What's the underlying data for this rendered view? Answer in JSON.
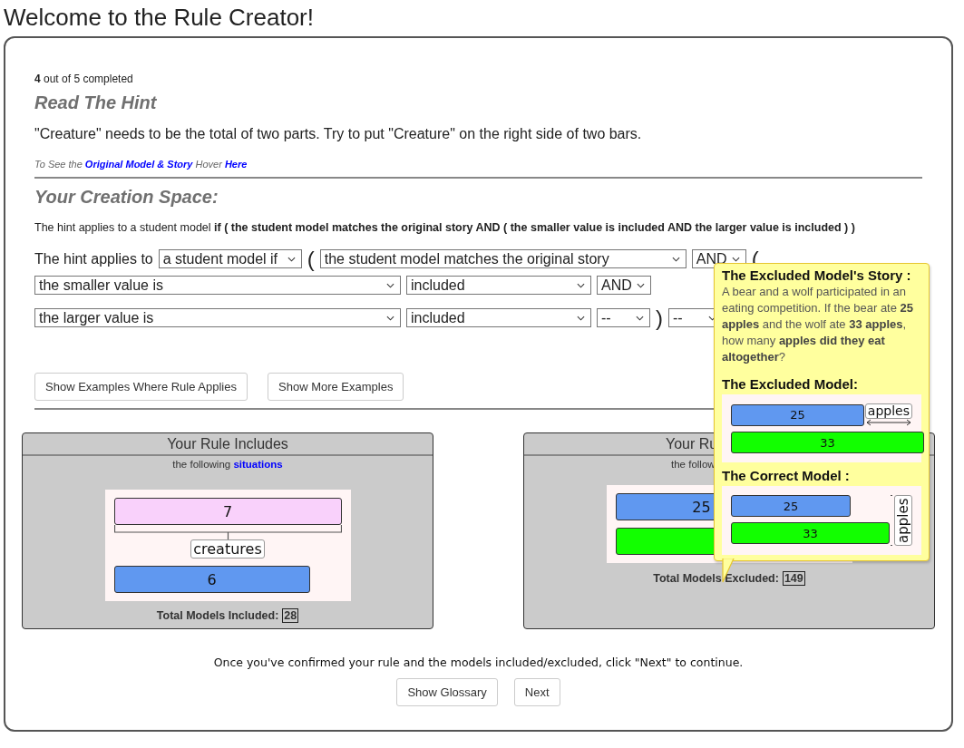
{
  "page_title": "Welcome to the Rule Creator!",
  "progress": {
    "count": "4",
    "text": "out of 5 completed"
  },
  "hint": {
    "heading": "Read The Hint",
    "text": "\"Creature\" needs to be the total of two parts. Try to put \"Creature\" on the right side of two bars.",
    "note_prefix": "To See the",
    "note_link": "Original Model & Story",
    "note_middle": "Hover",
    "note_link_2": "Here"
  },
  "creation": {
    "heading": "Your Creation Space:",
    "summary": "The hint applies to a student model **if ( the student model matches the original story AND ( the smaller value is included AND the larger value is included ) )**"
  },
  "rule_rows": [
    [
      {
        "kind": "text",
        "text": "The hint applies to"
      },
      {
        "kind": "select",
        "value": "a student model if"
      },
      {
        "kind": "paren",
        "text": "("
      },
      {
        "kind": "select",
        "value": "the student model matches the original story"
      },
      {
        "kind": "select",
        "value": "AND"
      },
      {
        "kind": "paren",
        "text": "("
      }
    ],
    [
      {
        "kind": "select",
        "value": "the smaller value is"
      },
      {
        "kind": "select",
        "value": "included"
      },
      {
        "kind": "select",
        "value": "AND"
      }
    ],
    [
      {
        "kind": "select",
        "value": "the larger value is"
      },
      {
        "kind": "select",
        "value": "included"
      },
      {
        "kind": "select",
        "value": "--"
      },
      {
        "kind": "paren",
        "text": ")"
      },
      {
        "kind": "select",
        "value": "--"
      }
    ]
  ],
  "example_buttons": [
    "Show Examples Where Rule Applies",
    "Show More Examples"
  ],
  "panels": [
    {
      "title": "Your Rule Includes",
      "subtitle": "the following",
      "link": "situations",
      "model": {
        "kind": "total_below",
        "label": "creatures",
        "bars": [
          {
            "text": "7",
            "color": "#f9d1fb"
          },
          {
            "text": "6",
            "color": "#6098f0"
          }
        ]
      },
      "total_label": "Total Models Included:",
      "total": "28"
    },
    {
      "title": "Your Ru",
      "subtitle": "the follow",
      "model": {
        "kind": "plain",
        "bars": [
          {
            "text": "25",
            "color": "#6098f0"
          },
          {
            "color": "#12ff00"
          }
        ]
      },
      "total_label": "Total Models Excluded:",
      "total": "149"
    }
  ],
  "tooltip": {
    "story_heading": "The Excluded Model's Story :",
    "story": "A bear and a wolf participated in an eating competition. If the bear ate **25 apples** and the wolf ate **33 apples**, how many **apples did they eat altogether**?",
    "excluded_heading": "The Excluded Model:",
    "excluded_model": {
      "kind": "side_arrow",
      "label": "apples",
      "bars": [
        {
          "text": "25",
          "color": "#6098f0"
        },
        {
          "text": "33",
          "color": "#12ff00"
        }
      ]
    },
    "correct_heading": "The Correct Model :",
    "correct_model": {
      "kind": "right_bracket",
      "label": "apples",
      "bars": [
        {
          "text": "25",
          "color": "#6098f0"
        },
        {
          "text": "33",
          "color": "#12ff00"
        }
      ]
    }
  },
  "footer": {
    "text": "Once you've confirmed your rule and the models included/excluded, click \"Next\" to continue.",
    "buttons": [
      "Show Glossary",
      "Next"
    ]
  }
}
